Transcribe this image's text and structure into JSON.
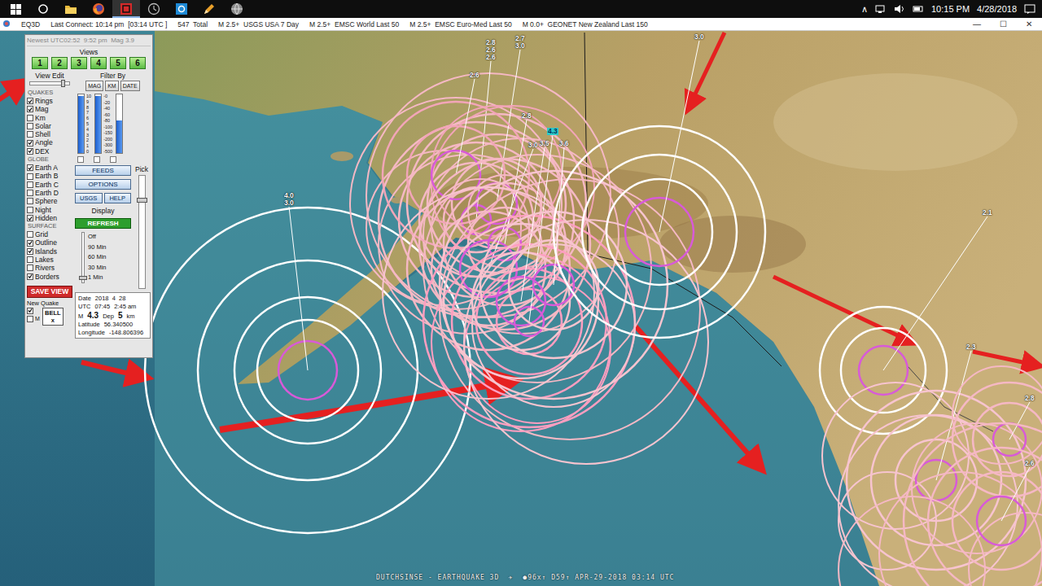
{
  "taskbar": {
    "items": [
      {
        "selected": false
      },
      {
        "selected": false
      },
      {
        "selected": false
      },
      {
        "selected": false
      },
      {
        "selected": true
      },
      {
        "selected": false
      },
      {
        "selected": false
      },
      {
        "selected": false
      },
      {
        "selected": false
      }
    ],
    "tray": {
      "chevron": "∧",
      "time": "10:15 PM",
      "date": "4/28/2018"
    }
  },
  "window": {
    "title": "EQ3D",
    "status": [
      "Last Connect: 10:14 pm  [03:14 UTC ]",
      "547  Total",
      "M 2.5+  USGS USA 7 Day",
      "M 2.5+  EMSC World Last 50",
      "M 2.5+  EMSC Euro-Med Last 50",
      "M 0.0+  GEONET New Zealand Last 150"
    ],
    "controls": [
      "—",
      "☐",
      "✕"
    ]
  },
  "panel": {
    "newest": "Newest UTC02:52  9:52 pm  Mag 3.9",
    "views": {
      "title": "Views",
      "buttons": [
        "1",
        "2",
        "3",
        "4",
        "5",
        "6"
      ]
    },
    "view_edit": {
      "title": "View Edit",
      "level": 0.85
    },
    "filter": {
      "title": "Filter By",
      "buttons": [
        "MAG",
        "KM",
        "DATE"
      ],
      "sliders": [
        {
          "level": 0.97,
          "scale": [
            "10",
            "9",
            "8",
            "7",
            "6",
            "5",
            "4",
            "3",
            "2",
            "1",
            "0"
          ]
        },
        {
          "level": 0.97,
          "scale": [
            "-0",
            "-20",
            "-40",
            "-60",
            "-80",
            "-100",
            "-150",
            "-200",
            "-300",
            "-500"
          ]
        },
        {
          "level": 0.55,
          "scale": []
        }
      ]
    },
    "groups": [
      {
        "title": "QUAKES",
        "items": [
          {
            "label": "Rings",
            "checked": true
          },
          {
            "label": "Mag",
            "checked": true
          },
          {
            "label": "Km",
            "checked": false
          },
          {
            "label": "Solar",
            "checked": false
          },
          {
            "label": "Shell",
            "checked": false
          },
          {
            "label": "Angle",
            "checked": true
          },
          {
            "label": "DEX",
            "checked": true
          }
        ]
      },
      {
        "title": "GLOBE",
        "items": [
          {
            "label": "Earth A",
            "checked": true
          },
          {
            "label": "Earth B",
            "checked": false
          },
          {
            "label": "Earth C",
            "checked": false
          },
          {
            "label": "Earth D",
            "checked": false
          },
          {
            "label": "Sphere",
            "checked": false
          },
          {
            "label": "Night",
            "checked": false
          },
          {
            "label": "Hidden",
            "checked": true
          }
        ]
      },
      {
        "title": "SURFACE",
        "items": [
          {
            "label": "Grid",
            "checked": false
          },
          {
            "label": "Outline",
            "checked": true
          },
          {
            "label": "Islands",
            "checked": true
          },
          {
            "label": "Lakes",
            "checked": false
          },
          {
            "label": "Rivers",
            "checked": false
          },
          {
            "label": "Borders",
            "checked": true
          }
        ]
      }
    ],
    "buttons": [
      "FEEDS",
      "OPTIONS"
    ],
    "small_buttons": [
      "USGS",
      "HELP"
    ],
    "display": {
      "title": "Display",
      "refresh": "REFRESH",
      "options": [
        {
          "label": "Off",
          "selected": false
        },
        {
          "label": "90 Min",
          "selected": false
        },
        {
          "label": "60 Min",
          "selected": false
        },
        {
          "label": "30 Min",
          "selected": false
        },
        {
          "label": "1 Min",
          "selected": true
        }
      ]
    },
    "pick": {
      "title": "Pick",
      "level": 0.78
    },
    "save_view": "SAVE VIEW",
    "new_quake": {
      "label": "New Quake",
      "checked": true
    },
    "m_box": {
      "label": "M",
      "checked": false
    },
    "bell": {
      "label": "BELL",
      "sub": "x"
    },
    "info": {
      "date_label": "Date",
      "date": "2018  4  28",
      "utc_label": "UTC",
      "utc": "07:45",
      "local": "2:45 am",
      "mag_label": "M",
      "mag": "4.3",
      "dep_label": "Dep",
      "dep": "5",
      "dep_unit": "km",
      "lat_label": "Latitude",
      "lat": "56.340500",
      "lon_label": "Longitude",
      "lon": "-148.806396"
    }
  },
  "quakes": [
    {
      "labels": [
        "4.0",
        "3.0"
      ],
      "color": "#ffffff",
      "selected": false
    },
    {
      "labels": [
        "2.8",
        "2.6",
        "2.6"
      ],
      "color": "#f5b8c4",
      "selected": false
    },
    {
      "labels": [
        "2.7",
        "3.0"
      ],
      "color": "#f5b8c4",
      "selected": false
    },
    {
      "labels": [
        "2.6"
      ],
      "color": "#f2a5b8",
      "selected": false
    },
    {
      "labels": [
        "2.8"
      ],
      "color": "#f5b8c4",
      "selected": false
    },
    {
      "labels": [
        "3.0"
      ],
      "color": "#f5b8c4",
      "selected": false
    },
    {
      "labels": [
        "4.3"
      ],
      "color": "#ff9ec0",
      "selected": true
    },
    {
      "labels": [
        "3.5"
      ],
      "color": "#f7c4cf",
      "selected": false
    },
    {
      "labels": [
        "3.6"
      ],
      "color": "#f7c4cf",
      "selected": false
    },
    {
      "labels": [
        "3.0"
      ],
      "color": "#ffffff",
      "selected": false
    },
    {
      "labels": [
        "2.1"
      ],
      "color": "#ffffff",
      "selected": false
    },
    {
      "labels": [
        "2.3"
      ],
      "color": "#f7c4cf",
      "selected": false
    },
    {
      "labels": [
        "2.8"
      ],
      "color": "#f5b8c4",
      "selected": false
    },
    {
      "labels": [
        "2.6"
      ],
      "color": "#f5b8c4",
      "selected": false
    }
  ],
  "footer": "DUTCHSINSE - EARTHQUAKE 3D  ✈  ●96x↑ D59↑ APR-29-2018 03:14 UTC"
}
